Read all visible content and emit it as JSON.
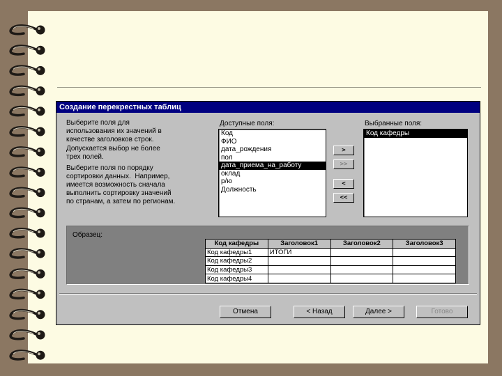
{
  "dialog": {
    "title": "Создание перекрестных таблиц",
    "instructions": {
      "p1": "Выберите поля для\nиспользования их значений в\nкачестве заголовков строк.",
      "p2": "Допускается выбор не более\nтрех полей.",
      "p3": "Выберите поля по порядку\nсортировки данных.  Например,\nимеется возможность сначала\nвыполнить сортировку значений\nпо странам, а затем по регионам."
    },
    "available_label": "Доступные поля:",
    "available_fields": [
      "Код",
      "ФИО",
      "дата_рождения",
      "пол",
      "дата_приема_на_работу",
      "оклад",
      "р/ю",
      "Должность"
    ],
    "available_selected": "дата_приема_на_работу",
    "selected_label": "Выбранные поля:",
    "selected_fields": [
      "Код кафедры"
    ],
    "move_buttons": [
      ">",
      ">>",
      "<",
      "<<"
    ],
    "sample_label": "Образец:",
    "sample_table": {
      "headers": [
        "Код кафедры",
        "Заголовок1",
        "Заголовок2",
        "Заголовок3"
      ],
      "rows": [
        [
          "Код кафедры1",
          "ИТОГИ",
          "",
          ""
        ],
        [
          "Код кафедры2",
          "",
          "",
          ""
        ],
        [
          "Код кафедры3",
          "",
          "",
          ""
        ],
        [
          "Код кафедры4",
          "",
          "",
          ""
        ]
      ]
    },
    "buttons": {
      "cancel": "Отмена",
      "back": "< Назад",
      "next": "Далее >",
      "finish": "Готово"
    }
  }
}
